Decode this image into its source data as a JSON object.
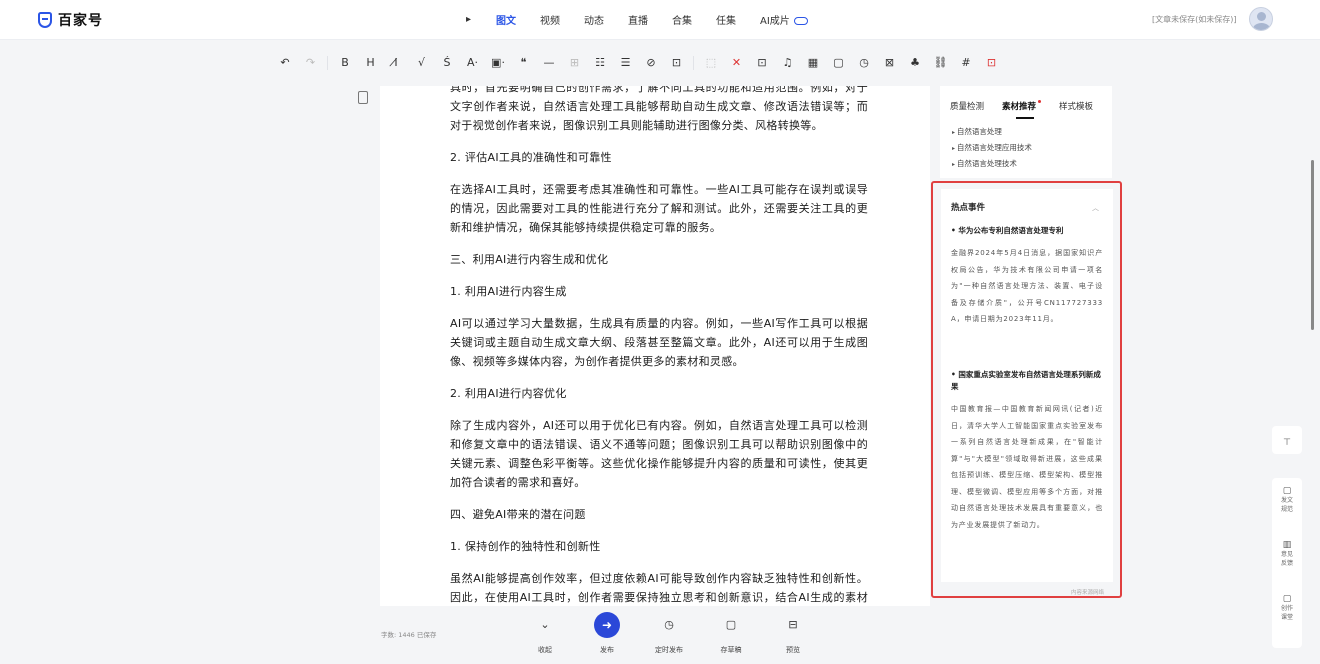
{
  "app": {
    "logo_text": "百家号",
    "save_status": "[文章未保存(如未保存)]"
  },
  "nav": {
    "back_icon": "▸",
    "items": [
      {
        "label": "图文",
        "active": true
      },
      {
        "label": "视频"
      },
      {
        "label": "动态"
      },
      {
        "label": "直播"
      },
      {
        "label": "合集"
      },
      {
        "label": "任集"
      },
      {
        "label": "AI成片"
      }
    ]
  },
  "toolbar": {
    "icons": [
      "↶",
      "↷",
      "B",
      "H",
      "I̸",
      "√",
      "Ś",
      "A·",
      "▣·",
      "❝",
      "—",
      "⊞",
      "☷",
      "☰",
      "⊘",
      "⊡",
      "⬚",
      "✕",
      "⊡",
      "♫",
      "▦",
      "▢",
      "◷",
      "⊠",
      "♣",
      "⛓",
      "#",
      "⊡"
    ]
  },
  "editor": {
    "paragraphs": [
      "具时，首先要明确自己的创作需求，了解不同工具的功能和适用范围。例如，对于文字创作者来说，自然语言处理工具能够帮助自动生成文章、修改语法错误等；而对于视觉创作者来说，图像识别工具则能辅助进行图像分类、风格转换等。",
      "2. 评估AI工具的准确性和可靠性",
      "在选择AI工具时，还需要考虑其准确性和可靠性。一些AI工具可能存在误判或误导的情况，因此需要对工具的性能进行充分了解和测试。此外，还需要关注工具的更新和维护情况，确保其能够持续提供稳定可靠的服务。",
      "三、利用AI进行内容生成和优化",
      "1. 利用AI进行内容生成",
      "AI可以通过学习大量数据，生成具有质量的内容。例如，一些AI写作工具可以根据关键词或主题自动生成文章大纲、段落甚至整篇文章。此外，AI还可以用于生成图像、视频等多媒体内容，为创作者提供更多的素材和灵感。",
      "2. 利用AI进行内容优化",
      "除了生成内容外，AI还可以用于优化已有内容。例如，自然语言处理工具可以检测和修复文章中的语法错误、语义不通等问题；图像识别工具可以帮助识别图像中的关键元素、调整色彩平衡等。这些优化操作能够提升内容的质量和可读性，使其更加符合读者的需求和喜好。",
      "四、避免AI带来的潜在问题",
      "1. 保持创作的独特性和创新性",
      "虽然AI能够提高创作效率，但过度依赖AI可能导致创作内容缺乏独特性和创新性。因此，在使用AI工具时，创作者需要保持独立思考和创新意识，结合AI生成的素材进行"
    ]
  },
  "side_tabs": {
    "items": [
      {
        "label": "质量检测"
      },
      {
        "label": "素材推荐",
        "active": true
      },
      {
        "label": "样式模板"
      }
    ]
  },
  "suggestions": [
    "自然语言处理",
    "自然语言处理应用技术",
    "自然语言处理技术"
  ],
  "hot": {
    "title": "热点事件",
    "items": [
      {
        "title": "华为公布专利自然语言处理专利",
        "body": "金融界2024年5月4日消息，据国家知识产权局公告，华为技术有限公司申请一项名为\"一种自然语言处理方法、装置、电子设备及存储介质\"，公开号CN117727333A，申请日期为2023年11月。"
      },
      {
        "title": "国家重点实验室发布自然语言处理系列新成果",
        "body": "中国教育报—中国教育新闻网讯(记者)近日，清华大学人工智能国家重点实验室发布一系列自然语言处理新成果，在\"智能计算\"与\"大模型\"领域取得新进展，这些成果包括预训练、模型压缩、模型架构、模型推理、模型微调、模型应用等多个方面，对推动自然语言处理技术发展具有重要意义，也为产业发展提供了新动力。"
      }
    ],
    "footer": "内容来源网络"
  },
  "bottom": {
    "word_count": "字数: 1446  已保存",
    "actions": [
      {
        "label": "收起",
        "icon": "⌄"
      },
      {
        "label": "发布",
        "icon": "➜",
        "primary": true
      },
      {
        "label": "定时发布",
        "icon": "◷"
      },
      {
        "label": "存草稿",
        "icon": "▢"
      },
      {
        "label": "预览",
        "icon": "⊟"
      }
    ]
  },
  "rail": {
    "top_icon": "⊤",
    "items": [
      {
        "icon": "▢",
        "label1": "发文",
        "label2": "规范"
      },
      {
        "icon": "▥",
        "label1": "意见",
        "label2": "反馈"
      },
      {
        "icon": "▢",
        "label1": "创作",
        "label2": "课堂"
      }
    ]
  }
}
